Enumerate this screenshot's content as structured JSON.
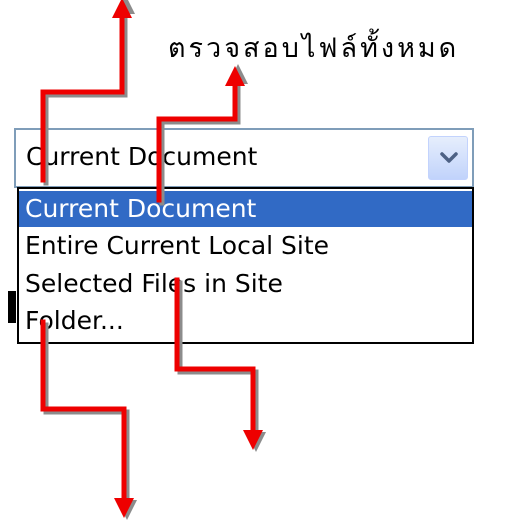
{
  "caption": "ตรวจสอบไฟล์ทั้งหมด",
  "dropdown": {
    "selected_value": "Current Document",
    "toggle_icon": "chevron-down-icon",
    "options": [
      "Current Document",
      "Entire Current Local Site",
      "Selected Files in Site",
      "Folder..."
    ]
  },
  "colors": {
    "arrow": "#ee0000",
    "arrow_shadow": "#8c8c8c",
    "selection": "#316ac5",
    "combo_border": "#7f9db9",
    "chevron": "#4d6185"
  }
}
